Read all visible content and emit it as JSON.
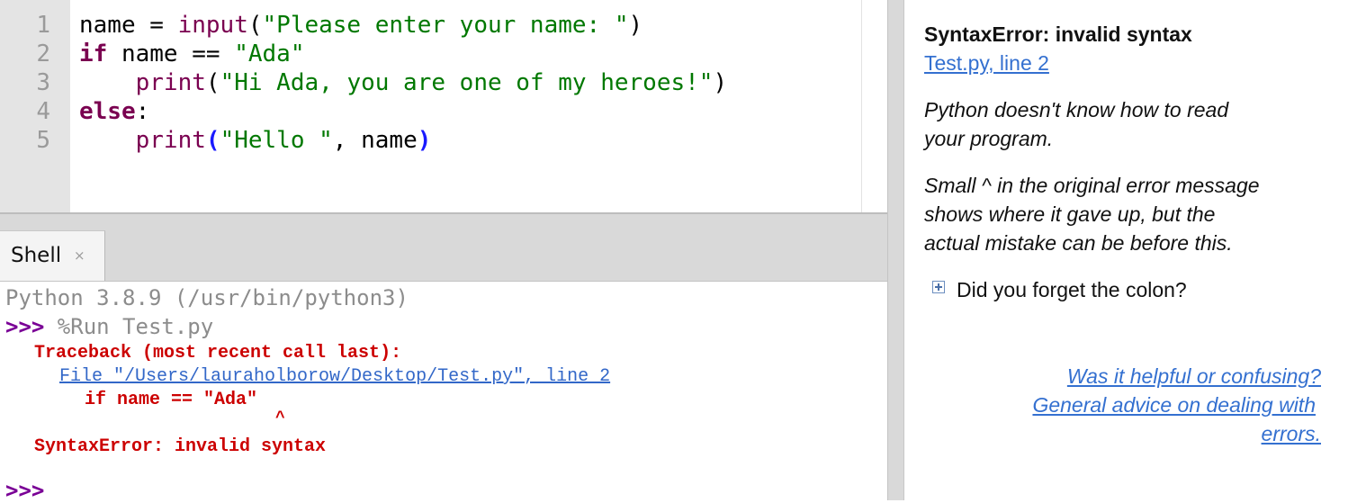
{
  "editor": {
    "line_numbers": [
      "1",
      "2",
      "3",
      "4",
      "5"
    ],
    "lines": {
      "l1": {
        "var": "name = ",
        "fn": "input",
        "open": "(",
        "str": "\"Please enter your name: \"",
        "close": ")"
      },
      "l2": {
        "kw": "if",
        "rest": " name == ",
        "str": "\"Ada\""
      },
      "l3": {
        "indent": "    ",
        "fn": "print",
        "open": "(",
        "str": "\"Hi Ada, you are one of my heroes!\"",
        "close": ")"
      },
      "l4": {
        "kw": "else",
        "colon": ":"
      },
      "l5": {
        "indent": "    ",
        "fn": "print",
        "open": "(",
        "str": "\"Hello \"",
        "rest": ", name",
        "close": ")"
      }
    }
  },
  "shell": {
    "tab_label": "Shell",
    "tab_close": "×",
    "banner": "Python 3.8.9 (/usr/bin/python3)",
    "prompt": ">>>",
    "run_cmd": " %Run Test.py",
    "traceback": "Traceback (most recent call last):",
    "file_link": "File \"/Users/lauraholborow/Desktop/Test.py\", line 2",
    "source_line": "if name == \"Ada\"",
    "caret": "^",
    "error": "SyntaxError: invalid syntax",
    "final_prompt": ">>>"
  },
  "assistant": {
    "title": "SyntaxError: invalid syntax",
    "location_link": "Test.py, line 2",
    "para1_line1": "Python doesn't know how to read",
    "para1_line2": "your program.",
    "para2_line1": "Small ^ in the original error message",
    "para2_line2": "shows where it gave up, but the",
    "para2_line3": "actual mistake can be before this.",
    "hint": "Did you forget the colon?",
    "feedback_link": "Was it helpful or confusing?",
    "advice_line1": "General advice on dealing with",
    "advice_line2": "errors."
  },
  "colors": {
    "keyword": "#7a0050",
    "string": "#007800",
    "error": "#cc0000",
    "link": "#3267c8",
    "prompt": "#7a0096"
  }
}
